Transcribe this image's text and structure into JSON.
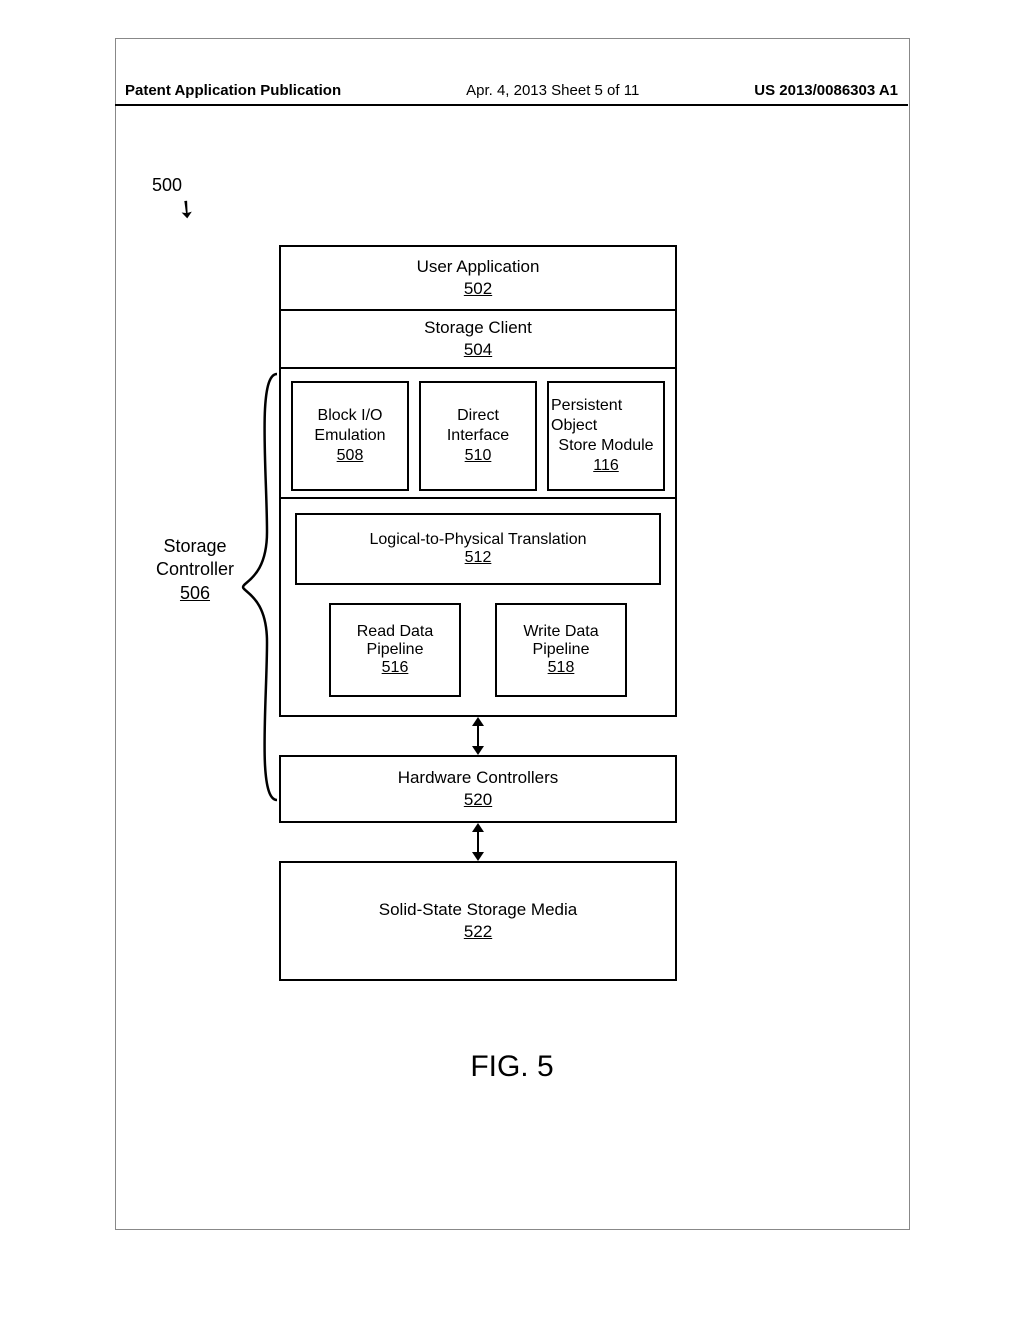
{
  "header": {
    "left": "Patent Application Publication",
    "center": "Apr. 4, 2013  Sheet 5 of 11",
    "right": "US 2013/0086303 A1"
  },
  "reference_numeral": "500",
  "controller_label": {
    "line1": "Storage",
    "line2": "Controller",
    "num": "506"
  },
  "blocks": {
    "user_app": {
      "title": "User Application",
      "num": "502"
    },
    "storage_client": {
      "title": "Storage Client",
      "num": "504"
    },
    "block_io": {
      "line1": "Block I/O",
      "line2": "Emulation",
      "num": "508"
    },
    "direct_if": {
      "line1": "Direct",
      "line2": "Interface",
      "num": "510"
    },
    "pos_module": {
      "line1": "Persistent Object",
      "line2": "Store Module",
      "num": "116"
    },
    "l2p": {
      "title": "Logical-to-Physical Translation",
      "num": "512"
    },
    "read_pipe": {
      "line1": "Read Data",
      "line2": "Pipeline",
      "num": "516"
    },
    "write_pipe": {
      "line1": "Write Data",
      "line2": "Pipeline",
      "num": "518"
    },
    "hw_ctrl": {
      "title": "Hardware Controllers",
      "num": "520"
    },
    "ss_media": {
      "title": "Solid-State Storage Media",
      "num": "522"
    }
  },
  "figure_caption": "FIG. 5"
}
